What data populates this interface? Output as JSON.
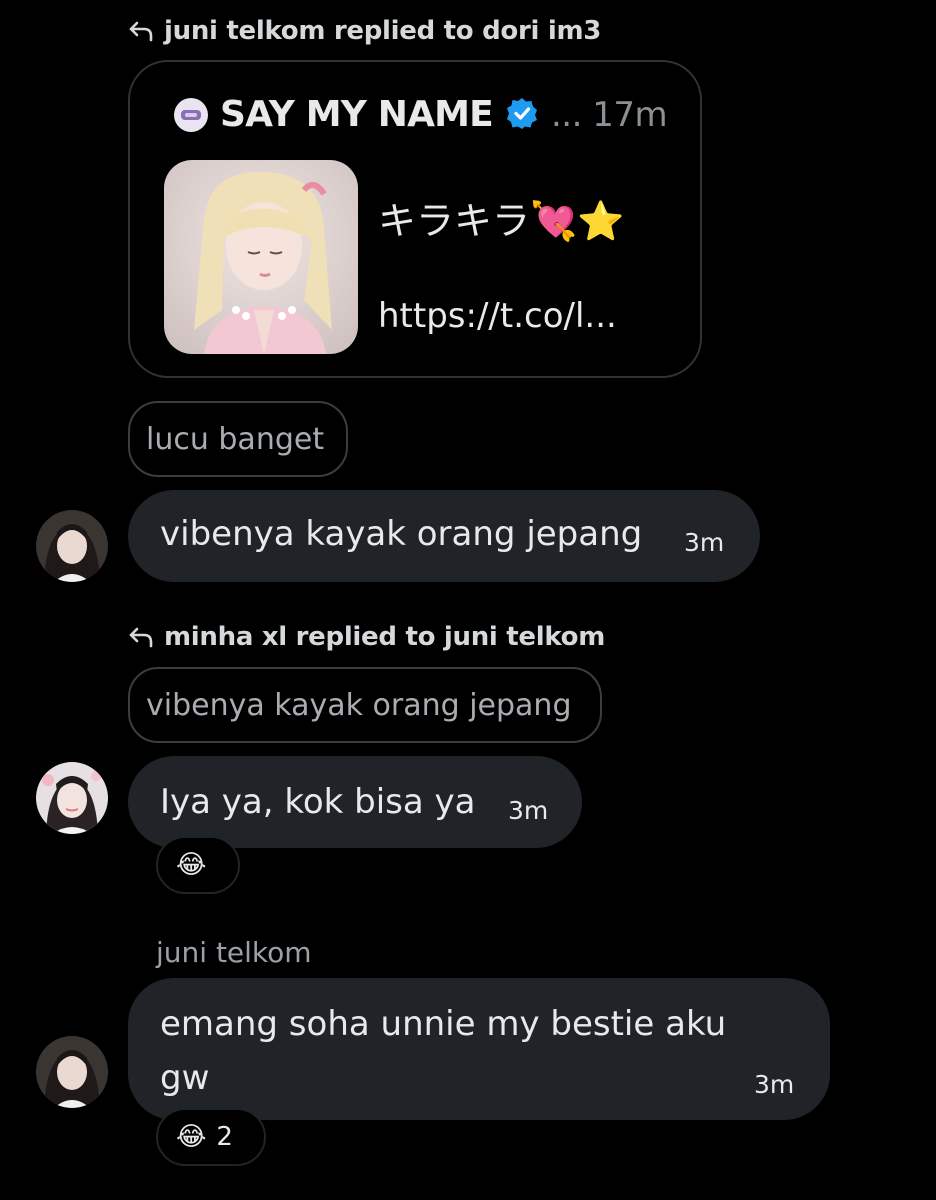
{
  "thread": {
    "reply1": {
      "text": "juni telkom replied to dori im3"
    },
    "quote": {
      "name": "SAY MY NAME",
      "meta": "... 17m",
      "text_line": "キラキラ💘⭐",
      "link": "https://t.co/l..."
    },
    "caption1": "lucu banget",
    "msg1": {
      "text": "vibenya kayak orang jepang",
      "time": "3m"
    },
    "reply2": {
      "text": "minha xl replied to juni telkom"
    },
    "quoted2": "vibenya kayak orang jepang",
    "msg2": {
      "text": "Iya ya, kok bisa ya",
      "time": "3m",
      "reaction_emoji": "😂"
    },
    "sender3": "juni telkom",
    "msg3": {
      "line1": "emang soha unnie my bestie aku",
      "line2": "gw",
      "time": "3m",
      "reaction_emoji": "😂",
      "reaction_count": "2"
    }
  },
  "colors": {
    "background": "#000000",
    "bubble": "#202327",
    "border": "#2f3336",
    "verified": "#1d9bf0"
  },
  "icons": [
    "reply-arrow-icon",
    "verified-badge-icon"
  ]
}
